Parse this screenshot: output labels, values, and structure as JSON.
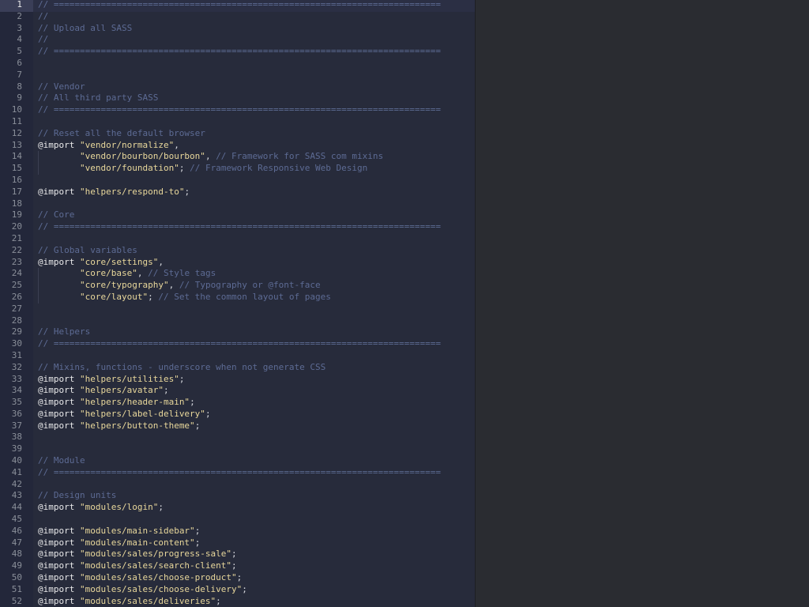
{
  "colors": {
    "editor_background": "#272b3b",
    "gutter_background": "#23273a",
    "right_pane_background": "#2a2c31",
    "comment": "#5d6b94",
    "keyword": "#e9e9ea",
    "string": "#e8d79b"
  },
  "editor": {
    "active_line": 1,
    "lines": [
      {
        "n": "1",
        "tokens": [
          {
            "t": "// ==========================================================================",
            "k": "comment"
          }
        ]
      },
      {
        "n": "2",
        "tokens": [
          {
            "t": "//",
            "k": "comment"
          }
        ]
      },
      {
        "n": "3",
        "tokens": [
          {
            "t": "// Upload all SASS",
            "k": "comment"
          }
        ]
      },
      {
        "n": "4",
        "tokens": [
          {
            "t": "//",
            "k": "comment"
          }
        ]
      },
      {
        "n": "5",
        "tokens": [
          {
            "t": "// ==========================================================================",
            "k": "comment"
          }
        ]
      },
      {
        "n": "6",
        "tokens": []
      },
      {
        "n": "7",
        "tokens": []
      },
      {
        "n": "8",
        "tokens": [
          {
            "t": "// Vendor",
            "k": "comment"
          }
        ]
      },
      {
        "n": "9",
        "tokens": [
          {
            "t": "// All third party SASS",
            "k": "comment"
          }
        ]
      },
      {
        "n": "10",
        "tokens": [
          {
            "t": "// ==========================================================================",
            "k": "comment"
          }
        ]
      },
      {
        "n": "11",
        "tokens": []
      },
      {
        "n": "12",
        "tokens": [
          {
            "t": "// Reset all the default browser",
            "k": "comment"
          }
        ]
      },
      {
        "n": "13",
        "tokens": [
          {
            "t": "@import",
            "k": "keyword"
          },
          {
            "t": " ",
            "k": "punct"
          },
          {
            "t": "\"vendor/normalize\"",
            "k": "string"
          },
          {
            "t": ",",
            "k": "punct"
          }
        ]
      },
      {
        "n": "14",
        "guide": true,
        "tokens": [
          {
            "t": "        ",
            "k": "punct"
          },
          {
            "t": "\"vendor/bourbon/bourbon\"",
            "k": "string"
          },
          {
            "t": ", ",
            "k": "punct"
          },
          {
            "t": "// Framework for SASS com mixins",
            "k": "comment"
          }
        ]
      },
      {
        "n": "15",
        "guide": true,
        "tokens": [
          {
            "t": "        ",
            "k": "punct"
          },
          {
            "t": "\"vendor/foundation\"",
            "k": "string"
          },
          {
            "t": "; ",
            "k": "punct"
          },
          {
            "t": "// Framework Responsive Web Design",
            "k": "comment"
          }
        ]
      },
      {
        "n": "16",
        "tokens": []
      },
      {
        "n": "17",
        "tokens": [
          {
            "t": "@import",
            "k": "keyword"
          },
          {
            "t": " ",
            "k": "punct"
          },
          {
            "t": "\"helpers/respond-to\"",
            "k": "string"
          },
          {
            "t": ";",
            "k": "punct"
          }
        ]
      },
      {
        "n": "18",
        "tokens": []
      },
      {
        "n": "19",
        "tokens": [
          {
            "t": "// Core",
            "k": "comment"
          }
        ]
      },
      {
        "n": "20",
        "tokens": [
          {
            "t": "// ==========================================================================",
            "k": "comment"
          }
        ]
      },
      {
        "n": "21",
        "tokens": []
      },
      {
        "n": "22",
        "tokens": [
          {
            "t": "// Global variables",
            "k": "comment"
          }
        ]
      },
      {
        "n": "23",
        "tokens": [
          {
            "t": "@import",
            "k": "keyword"
          },
          {
            "t": " ",
            "k": "punct"
          },
          {
            "t": "\"core/settings\"",
            "k": "string"
          },
          {
            "t": ",",
            "k": "punct"
          }
        ]
      },
      {
        "n": "24",
        "guide": true,
        "tokens": [
          {
            "t": "        ",
            "k": "punct"
          },
          {
            "t": "\"core/base\"",
            "k": "string"
          },
          {
            "t": ", ",
            "k": "punct"
          },
          {
            "t": "// Style tags",
            "k": "comment"
          }
        ]
      },
      {
        "n": "25",
        "guide": true,
        "tokens": [
          {
            "t": "        ",
            "k": "punct"
          },
          {
            "t": "\"core/typography\"",
            "k": "string"
          },
          {
            "t": ", ",
            "k": "punct"
          },
          {
            "t": "// Typography or @font-face",
            "k": "comment"
          }
        ]
      },
      {
        "n": "26",
        "guide": true,
        "tokens": [
          {
            "t": "        ",
            "k": "punct"
          },
          {
            "t": "\"core/layout\"",
            "k": "string"
          },
          {
            "t": "; ",
            "k": "punct"
          },
          {
            "t": "// Set the common layout of pages",
            "k": "comment"
          }
        ]
      },
      {
        "n": "27",
        "tokens": []
      },
      {
        "n": "28",
        "tokens": []
      },
      {
        "n": "29",
        "tokens": [
          {
            "t": "// Helpers",
            "k": "comment"
          }
        ]
      },
      {
        "n": "30",
        "tokens": [
          {
            "t": "// ==========================================================================",
            "k": "comment"
          }
        ]
      },
      {
        "n": "31",
        "tokens": []
      },
      {
        "n": "32",
        "tokens": [
          {
            "t": "// Mixins, functions - underscore when not generate CSS",
            "k": "comment"
          }
        ]
      },
      {
        "n": "33",
        "tokens": [
          {
            "t": "@import",
            "k": "keyword"
          },
          {
            "t": " ",
            "k": "punct"
          },
          {
            "t": "\"helpers/utilities\"",
            "k": "string"
          },
          {
            "t": ";",
            "k": "punct"
          }
        ]
      },
      {
        "n": "34",
        "tokens": [
          {
            "t": "@import",
            "k": "keyword"
          },
          {
            "t": " ",
            "k": "punct"
          },
          {
            "t": "\"helpers/avatar\"",
            "k": "string"
          },
          {
            "t": ";",
            "k": "punct"
          }
        ]
      },
      {
        "n": "35",
        "tokens": [
          {
            "t": "@import",
            "k": "keyword"
          },
          {
            "t": " ",
            "k": "punct"
          },
          {
            "t": "\"helpers/header-main\"",
            "k": "string"
          },
          {
            "t": ";",
            "k": "punct"
          }
        ]
      },
      {
        "n": "36",
        "tokens": [
          {
            "t": "@import",
            "k": "keyword"
          },
          {
            "t": " ",
            "k": "punct"
          },
          {
            "t": "\"helpers/label-delivery\"",
            "k": "string"
          },
          {
            "t": ";",
            "k": "punct"
          }
        ]
      },
      {
        "n": "37",
        "tokens": [
          {
            "t": "@import",
            "k": "keyword"
          },
          {
            "t": " ",
            "k": "punct"
          },
          {
            "t": "\"helpers/button-theme\"",
            "k": "string"
          },
          {
            "t": ";",
            "k": "punct"
          }
        ]
      },
      {
        "n": "38",
        "tokens": []
      },
      {
        "n": "39",
        "tokens": []
      },
      {
        "n": "40",
        "tokens": [
          {
            "t": "// Module",
            "k": "comment"
          }
        ]
      },
      {
        "n": "41",
        "tokens": [
          {
            "t": "// ==========================================================================",
            "k": "comment"
          }
        ]
      },
      {
        "n": "42",
        "tokens": []
      },
      {
        "n": "43",
        "tokens": [
          {
            "t": "// Design units",
            "k": "comment"
          }
        ]
      },
      {
        "n": "44",
        "tokens": [
          {
            "t": "@import",
            "k": "keyword"
          },
          {
            "t": " ",
            "k": "punct"
          },
          {
            "t": "\"modules/login\"",
            "k": "string"
          },
          {
            "t": ";",
            "k": "punct"
          }
        ]
      },
      {
        "n": "45",
        "tokens": []
      },
      {
        "n": "46",
        "tokens": [
          {
            "t": "@import",
            "k": "keyword"
          },
          {
            "t": " ",
            "k": "punct"
          },
          {
            "t": "\"modules/main-sidebar\"",
            "k": "string"
          },
          {
            "t": ";",
            "k": "punct"
          }
        ]
      },
      {
        "n": "47",
        "tokens": [
          {
            "t": "@import",
            "k": "keyword"
          },
          {
            "t": " ",
            "k": "punct"
          },
          {
            "t": "\"modules/main-content\"",
            "k": "string"
          },
          {
            "t": ";",
            "k": "punct"
          }
        ]
      },
      {
        "n": "48",
        "tokens": [
          {
            "t": "@import",
            "k": "keyword"
          },
          {
            "t": " ",
            "k": "punct"
          },
          {
            "t": "\"modules/sales/progress-sale\"",
            "k": "string"
          },
          {
            "t": ";",
            "k": "punct"
          }
        ]
      },
      {
        "n": "49",
        "tokens": [
          {
            "t": "@import",
            "k": "keyword"
          },
          {
            "t": " ",
            "k": "punct"
          },
          {
            "t": "\"modules/sales/search-client\"",
            "k": "string"
          },
          {
            "t": ";",
            "k": "punct"
          }
        ]
      },
      {
        "n": "50",
        "tokens": [
          {
            "t": "@import",
            "k": "keyword"
          },
          {
            "t": " ",
            "k": "punct"
          },
          {
            "t": "\"modules/sales/choose-product\"",
            "k": "string"
          },
          {
            "t": ";",
            "k": "punct"
          }
        ]
      },
      {
        "n": "51",
        "tokens": [
          {
            "t": "@import",
            "k": "keyword"
          },
          {
            "t": " ",
            "k": "punct"
          },
          {
            "t": "\"modules/sales/choose-delivery\"",
            "k": "string"
          },
          {
            "t": ";",
            "k": "punct"
          }
        ]
      },
      {
        "n": "52",
        "tokens": [
          {
            "t": "@import",
            "k": "keyword"
          },
          {
            "t": " ",
            "k": "punct"
          },
          {
            "t": "\"modules/sales/deliveries\"",
            "k": "string"
          },
          {
            "t": ";",
            "k": "punct"
          }
        ]
      }
    ]
  }
}
